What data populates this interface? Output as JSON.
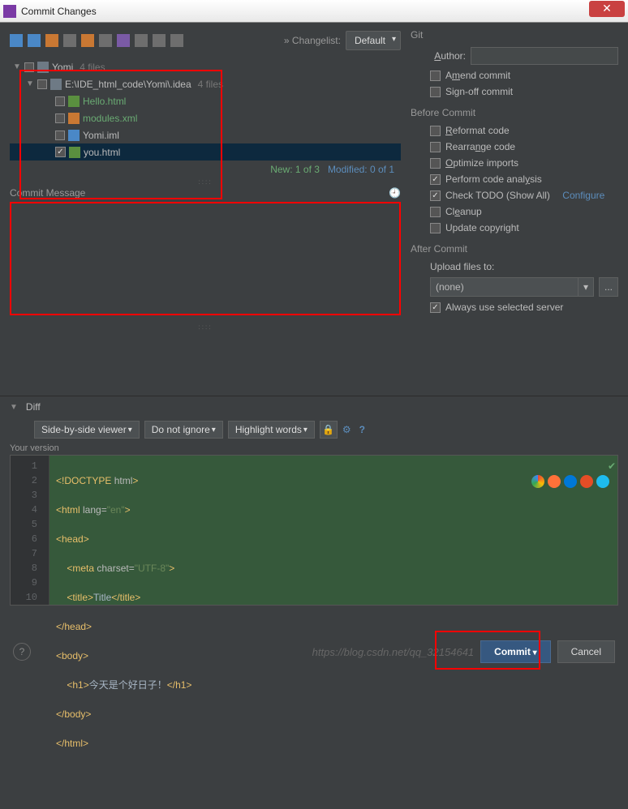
{
  "window": {
    "title": "Commit Changes"
  },
  "toolbar": {
    "changelist_label": "» Changelist:",
    "changelist_value": "Default"
  },
  "tree": {
    "root": {
      "name": "Yomi",
      "count": "4 files"
    },
    "path": {
      "name": "E:\\IDE_html_code\\Yomi\\.idea",
      "count": "4 files"
    },
    "files": [
      {
        "name": "Hello.html",
        "status": "new"
      },
      {
        "name": "modules.xml",
        "status": "new"
      },
      {
        "name": "Yomi.iml",
        "status": "norm"
      },
      {
        "name": "you.html",
        "status": "norm",
        "selected": true,
        "checked": true
      }
    ]
  },
  "status": {
    "new": "New: 1 of 3",
    "modified": "Modified: 0 of 1"
  },
  "commit_message": {
    "label": "Commit Message"
  },
  "git": {
    "title": "Git",
    "author_label": "Author:",
    "amend": "Amend commit",
    "signoff": "Sign-off commit"
  },
  "before": {
    "title": "Before Commit",
    "reformat": "Reformat code",
    "rearrange": "Rearrange code",
    "optimize": "Optimize imports",
    "analysis": "Perform code analysis",
    "todo": "Check TODO (Show All)",
    "configure": "Configure",
    "cleanup": "Cleanup",
    "copyright": "Update copyright"
  },
  "after": {
    "title": "After Commit",
    "upload_label": "Upload files to:",
    "upload_value": "(none)",
    "always_server": "Always use selected server"
  },
  "diff": {
    "title": "Diff",
    "viewer": "Side-by-side viewer",
    "ignore": "Do not ignore",
    "highlight": "Highlight words",
    "your_version": "Your version"
  },
  "code": {
    "lines": [
      "<!DOCTYPE html>",
      "<html lang=\"en\">",
      "<head>",
      "    <meta charset=\"UTF-8\">",
      "    <title>Title</title>",
      "</head>",
      "<body>",
      "    <h1>今天是个好日子！</h1>",
      "</body>",
      "</html>"
    ]
  },
  "footer": {
    "watermark": "https://blog.csdn.net/qq_32154641",
    "commit": "Commit",
    "cancel": "Cancel"
  }
}
